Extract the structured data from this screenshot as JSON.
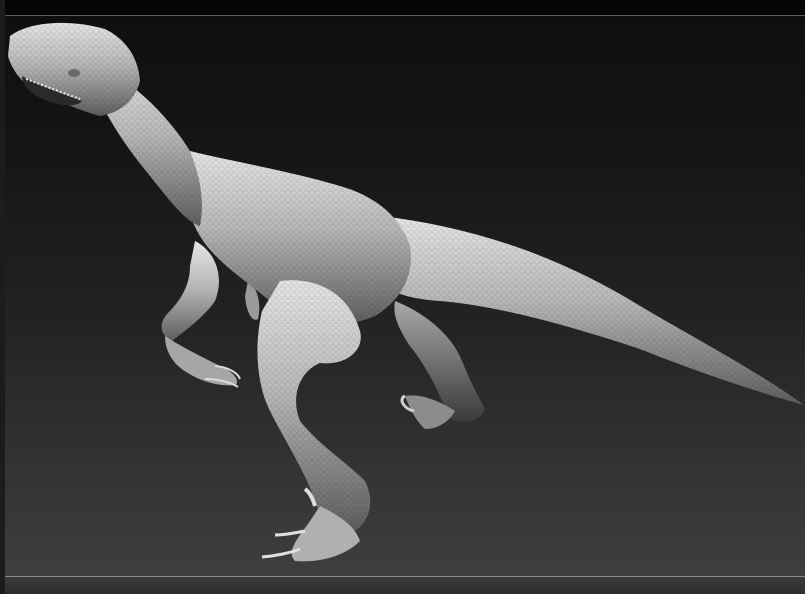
{
  "viewport": {
    "background_top": "#0f0f0f",
    "background_bottom": "#3e3e3e",
    "frame_line_color": "#8a8a8a"
  },
  "model": {
    "subject": "raptor-sculpt",
    "material_color": "#bdbdbd"
  }
}
